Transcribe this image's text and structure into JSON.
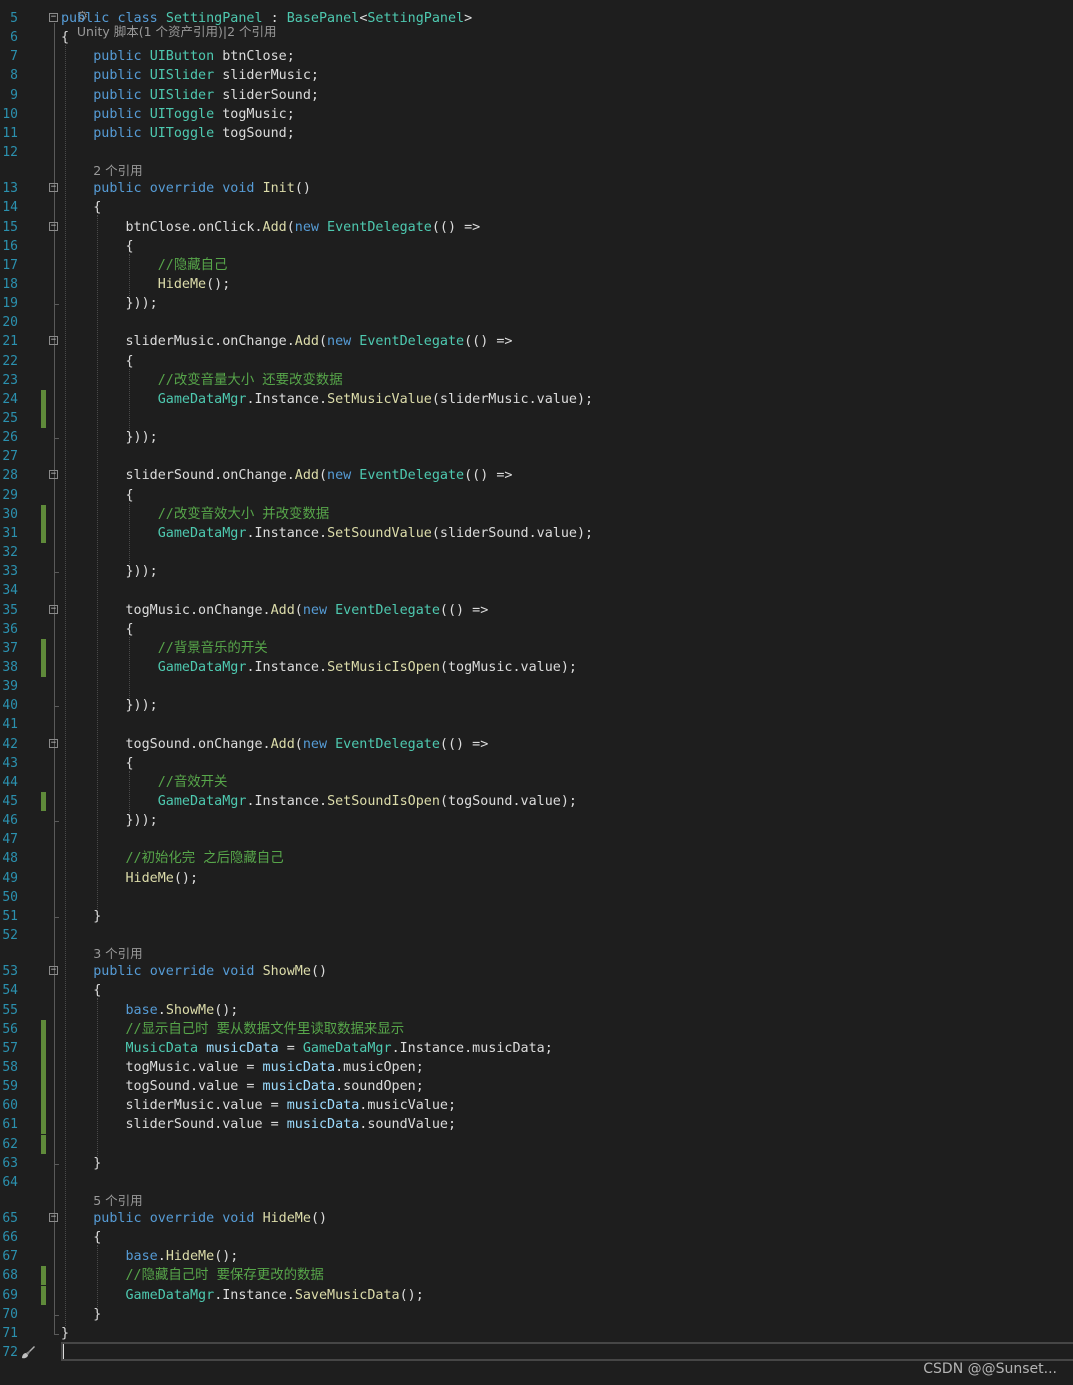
{
  "editor": {
    "top_codelens": "Unity 脚本(1 个资产引用)|2 个引用",
    "watermark": "CSDN @@Sunset...",
    "current_line": 72,
    "colors": {
      "background": "#1e1e1e",
      "line_number": "#2b91af",
      "keyword": "#569cd6",
      "type": "#4ec9b0",
      "method": "#dcdcaa",
      "variable": "#9cdcfe",
      "comment": "#57a64a",
      "plain": "#dcdcdc",
      "codelens": "#999999",
      "change_marker": "#5f8a3a"
    }
  },
  "lines": [
    {
      "n": 5,
      "tokens": [
        [
          "kw",
          "public "
        ],
        [
          "kw",
          "class "
        ],
        [
          "type",
          "SettingPanel"
        ],
        [
          "pl",
          " : "
        ],
        [
          "type",
          "BasePanel"
        ],
        [
          "pl",
          "<"
        ],
        [
          "type",
          "SettingPanel"
        ],
        [
          "pl",
          ">"
        ]
      ],
      "fold": true
    },
    {
      "n": 6,
      "tokens": [
        [
          "pl",
          "{"
        ]
      ]
    },
    {
      "n": 7,
      "tokens": [
        [
          "pl",
          "    "
        ],
        [
          "kw",
          "public "
        ],
        [
          "type",
          "UIButton"
        ],
        [
          "pl",
          " btnClose;"
        ]
      ]
    },
    {
      "n": 8,
      "tokens": [
        [
          "pl",
          "    "
        ],
        [
          "kw",
          "public "
        ],
        [
          "type",
          "UISlider"
        ],
        [
          "pl",
          " sliderMusic;"
        ]
      ]
    },
    {
      "n": 9,
      "tokens": [
        [
          "pl",
          "    "
        ],
        [
          "kw",
          "public "
        ],
        [
          "type",
          "UISlider"
        ],
        [
          "pl",
          " sliderSound;"
        ]
      ]
    },
    {
      "n": 10,
      "tokens": [
        [
          "pl",
          "    "
        ],
        [
          "kw",
          "public "
        ],
        [
          "type",
          "UIToggle"
        ],
        [
          "pl",
          " togMusic;"
        ]
      ]
    },
    {
      "n": 11,
      "tokens": [
        [
          "pl",
          "    "
        ],
        [
          "kw",
          "public "
        ],
        [
          "type",
          "UIToggle"
        ],
        [
          "pl",
          " togSound;"
        ]
      ]
    },
    {
      "n": 12,
      "tokens": []
    },
    {
      "n": 13,
      "codelens": "2 个引用",
      "tokens": [
        [
          "pl",
          "    "
        ],
        [
          "kw",
          "public "
        ],
        [
          "kw",
          "override "
        ],
        [
          "kw",
          "void "
        ],
        [
          "fn",
          "Init"
        ],
        [
          "pl",
          "()"
        ]
      ],
      "fold": true
    },
    {
      "n": 14,
      "tokens": [
        [
          "pl",
          "    {"
        ]
      ]
    },
    {
      "n": 15,
      "tokens": [
        [
          "pl",
          "        btnClose.onClick."
        ],
        [
          "fn",
          "Add"
        ],
        [
          "pl",
          "("
        ],
        [
          "kw",
          "new "
        ],
        [
          "type",
          "EventDelegate"
        ],
        [
          "pl",
          "(() =>"
        ]
      ],
      "fold": true
    },
    {
      "n": 16,
      "tokens": [
        [
          "pl",
          "        {"
        ]
      ]
    },
    {
      "n": 17,
      "tokens": [
        [
          "pl",
          "            "
        ],
        [
          "cm",
          "//隐藏自己"
        ]
      ]
    },
    {
      "n": 18,
      "tokens": [
        [
          "pl",
          "            "
        ],
        [
          "fn",
          "HideMe"
        ],
        [
          "pl",
          "();"
        ]
      ]
    },
    {
      "n": 19,
      "tokens": [
        [
          "pl",
          "        }));"
        ]
      ]
    },
    {
      "n": 20,
      "tokens": []
    },
    {
      "n": 21,
      "tokens": [
        [
          "pl",
          "        sliderMusic.onChange."
        ],
        [
          "fn",
          "Add"
        ],
        [
          "pl",
          "("
        ],
        [
          "kw",
          "new "
        ],
        [
          "type",
          "EventDelegate"
        ],
        [
          "pl",
          "(() =>"
        ]
      ],
      "fold": true
    },
    {
      "n": 22,
      "tokens": [
        [
          "pl",
          "        {"
        ]
      ]
    },
    {
      "n": 23,
      "tokens": [
        [
          "pl",
          "            "
        ],
        [
          "cm",
          "//改变音量大小 还要改变数据"
        ]
      ]
    },
    {
      "n": 24,
      "tokens": [
        [
          "pl",
          "            "
        ],
        [
          "type",
          "GameDataMgr"
        ],
        [
          "pl",
          ".Instance."
        ],
        [
          "fn",
          "SetMusicValue"
        ],
        [
          "pl",
          "(sliderMusic.value);"
        ]
      ],
      "changed": true
    },
    {
      "n": 25,
      "tokens": [],
      "changed": true
    },
    {
      "n": 26,
      "tokens": [
        [
          "pl",
          "        }));"
        ]
      ]
    },
    {
      "n": 27,
      "tokens": []
    },
    {
      "n": 28,
      "tokens": [
        [
          "pl",
          "        sliderSound.onChange."
        ],
        [
          "fn",
          "Add"
        ],
        [
          "pl",
          "("
        ],
        [
          "kw",
          "new "
        ],
        [
          "type",
          "EventDelegate"
        ],
        [
          "pl",
          "(() =>"
        ]
      ],
      "fold": true
    },
    {
      "n": 29,
      "tokens": [
        [
          "pl",
          "        {"
        ]
      ]
    },
    {
      "n": 30,
      "tokens": [
        [
          "pl",
          "            "
        ],
        [
          "cm",
          "//改变音效大小 并改变数据"
        ]
      ],
      "changed": true
    },
    {
      "n": 31,
      "tokens": [
        [
          "pl",
          "            "
        ],
        [
          "type",
          "GameDataMgr"
        ],
        [
          "pl",
          ".Instance."
        ],
        [
          "fn",
          "SetSoundValue"
        ],
        [
          "pl",
          "(sliderSound.value);"
        ]
      ],
      "changed": true
    },
    {
      "n": 32,
      "tokens": []
    },
    {
      "n": 33,
      "tokens": [
        [
          "pl",
          "        }));"
        ]
      ]
    },
    {
      "n": 34,
      "tokens": []
    },
    {
      "n": 35,
      "tokens": [
        [
          "pl",
          "        togMusic.onChange."
        ],
        [
          "fn",
          "Add"
        ],
        [
          "pl",
          "("
        ],
        [
          "kw",
          "new "
        ],
        [
          "type",
          "EventDelegate"
        ],
        [
          "pl",
          "(() =>"
        ]
      ],
      "fold": true
    },
    {
      "n": 36,
      "tokens": [
        [
          "pl",
          "        {"
        ]
      ]
    },
    {
      "n": 37,
      "tokens": [
        [
          "pl",
          "            "
        ],
        [
          "cm",
          "//背景音乐的开关"
        ]
      ],
      "changed": true
    },
    {
      "n": 38,
      "tokens": [
        [
          "pl",
          "            "
        ],
        [
          "type",
          "GameDataMgr"
        ],
        [
          "pl",
          ".Instance."
        ],
        [
          "fn",
          "SetMusicIsOpen"
        ],
        [
          "pl",
          "(togMusic.value);"
        ]
      ],
      "changed": true
    },
    {
      "n": 39,
      "tokens": []
    },
    {
      "n": 40,
      "tokens": [
        [
          "pl",
          "        }));"
        ]
      ]
    },
    {
      "n": 41,
      "tokens": []
    },
    {
      "n": 42,
      "tokens": [
        [
          "pl",
          "        togSound.onChange."
        ],
        [
          "fn",
          "Add"
        ],
        [
          "pl",
          "("
        ],
        [
          "kw",
          "new "
        ],
        [
          "type",
          "EventDelegate"
        ],
        [
          "pl",
          "(() =>"
        ]
      ],
      "fold": true
    },
    {
      "n": 43,
      "tokens": [
        [
          "pl",
          "        {"
        ]
      ]
    },
    {
      "n": 44,
      "tokens": [
        [
          "pl",
          "            "
        ],
        [
          "cm",
          "//音效开关"
        ]
      ]
    },
    {
      "n": 45,
      "tokens": [
        [
          "pl",
          "            "
        ],
        [
          "type",
          "GameDataMgr"
        ],
        [
          "pl",
          ".Instance."
        ],
        [
          "fn",
          "SetSoundIsOpen"
        ],
        [
          "pl",
          "(togSound.value);"
        ]
      ],
      "changed": true
    },
    {
      "n": 46,
      "tokens": [
        [
          "pl",
          "        }));"
        ]
      ]
    },
    {
      "n": 47,
      "tokens": []
    },
    {
      "n": 48,
      "tokens": [
        [
          "pl",
          "        "
        ],
        [
          "cm",
          "//初始化完 之后隐藏自己"
        ]
      ]
    },
    {
      "n": 49,
      "tokens": [
        [
          "pl",
          "        "
        ],
        [
          "fn",
          "HideMe"
        ],
        [
          "pl",
          "();"
        ]
      ]
    },
    {
      "n": 50,
      "tokens": []
    },
    {
      "n": 51,
      "tokens": [
        [
          "pl",
          "    }"
        ]
      ]
    },
    {
      "n": 52,
      "tokens": []
    },
    {
      "n": 53,
      "codelens": "3 个引用",
      "tokens": [
        [
          "pl",
          "    "
        ],
        [
          "kw",
          "public "
        ],
        [
          "kw",
          "override "
        ],
        [
          "kw",
          "void "
        ],
        [
          "fn",
          "ShowMe"
        ],
        [
          "pl",
          "()"
        ]
      ],
      "fold": true
    },
    {
      "n": 54,
      "tokens": [
        [
          "pl",
          "    {"
        ]
      ]
    },
    {
      "n": 55,
      "tokens": [
        [
          "pl",
          "        "
        ],
        [
          "kw",
          "base"
        ],
        [
          "pl",
          "."
        ],
        [
          "fn",
          "ShowMe"
        ],
        [
          "pl",
          "();"
        ]
      ]
    },
    {
      "n": 56,
      "tokens": [
        [
          "pl",
          "        "
        ],
        [
          "cm",
          "//显示自己时 要从数据文件里读取数据来显示"
        ]
      ],
      "changed": true
    },
    {
      "n": 57,
      "tokens": [
        [
          "pl",
          "        "
        ],
        [
          "type",
          "MusicData"
        ],
        [
          "pl",
          " "
        ],
        [
          "var",
          "musicData"
        ],
        [
          "pl",
          " = "
        ],
        [
          "type",
          "GameDataMgr"
        ],
        [
          "pl",
          ".Instance.musicData;"
        ]
      ],
      "changed": true
    },
    {
      "n": 58,
      "tokens": [
        [
          "pl",
          "        togMusic.value = "
        ],
        [
          "var",
          "musicData"
        ],
        [
          "pl",
          ".musicOpen;"
        ]
      ],
      "changed": true
    },
    {
      "n": 59,
      "tokens": [
        [
          "pl",
          "        togSound.value = "
        ],
        [
          "var",
          "musicData"
        ],
        [
          "pl",
          ".soundOpen;"
        ]
      ],
      "changed": true
    },
    {
      "n": 60,
      "tokens": [
        [
          "pl",
          "        sliderMusic.value = "
        ],
        [
          "var",
          "musicData"
        ],
        [
          "pl",
          ".musicValue;"
        ]
      ],
      "changed": true
    },
    {
      "n": 61,
      "tokens": [
        [
          "pl",
          "        sliderSound.value = "
        ],
        [
          "var",
          "musicData"
        ],
        [
          "pl",
          ".soundValue;"
        ]
      ],
      "changed": true
    },
    {
      "n": 62,
      "tokens": [],
      "changed": true
    },
    {
      "n": 63,
      "tokens": [
        [
          "pl",
          "    }"
        ]
      ]
    },
    {
      "n": 64,
      "tokens": []
    },
    {
      "n": 65,
      "codelens": "5 个引用",
      "tokens": [
        [
          "pl",
          "    "
        ],
        [
          "kw",
          "public "
        ],
        [
          "kw",
          "override "
        ],
        [
          "kw",
          "void "
        ],
        [
          "fn",
          "HideMe"
        ],
        [
          "pl",
          "()"
        ]
      ],
      "fold": true
    },
    {
      "n": 66,
      "tokens": [
        [
          "pl",
          "    {"
        ]
      ]
    },
    {
      "n": 67,
      "tokens": [
        [
          "pl",
          "        "
        ],
        [
          "kw",
          "base"
        ],
        [
          "pl",
          "."
        ],
        [
          "fn",
          "HideMe"
        ],
        [
          "pl",
          "();"
        ]
      ]
    },
    {
      "n": 68,
      "tokens": [
        [
          "pl",
          "        "
        ],
        [
          "cm",
          "//隐藏自己时 要保存更改的数据"
        ]
      ],
      "changed": true
    },
    {
      "n": 69,
      "tokens": [
        [
          "pl",
          "        "
        ],
        [
          "type",
          "GameDataMgr"
        ],
        [
          "pl",
          ".Instance."
        ],
        [
          "fn",
          "SaveMusicData"
        ],
        [
          "pl",
          "();"
        ]
      ],
      "changed": true
    },
    {
      "n": 70,
      "tokens": [
        [
          "pl",
          "    }"
        ]
      ]
    },
    {
      "n": 71,
      "tokens": [
        [
          "pl",
          "}"
        ]
      ]
    },
    {
      "n": 72,
      "tokens": []
    }
  ]
}
